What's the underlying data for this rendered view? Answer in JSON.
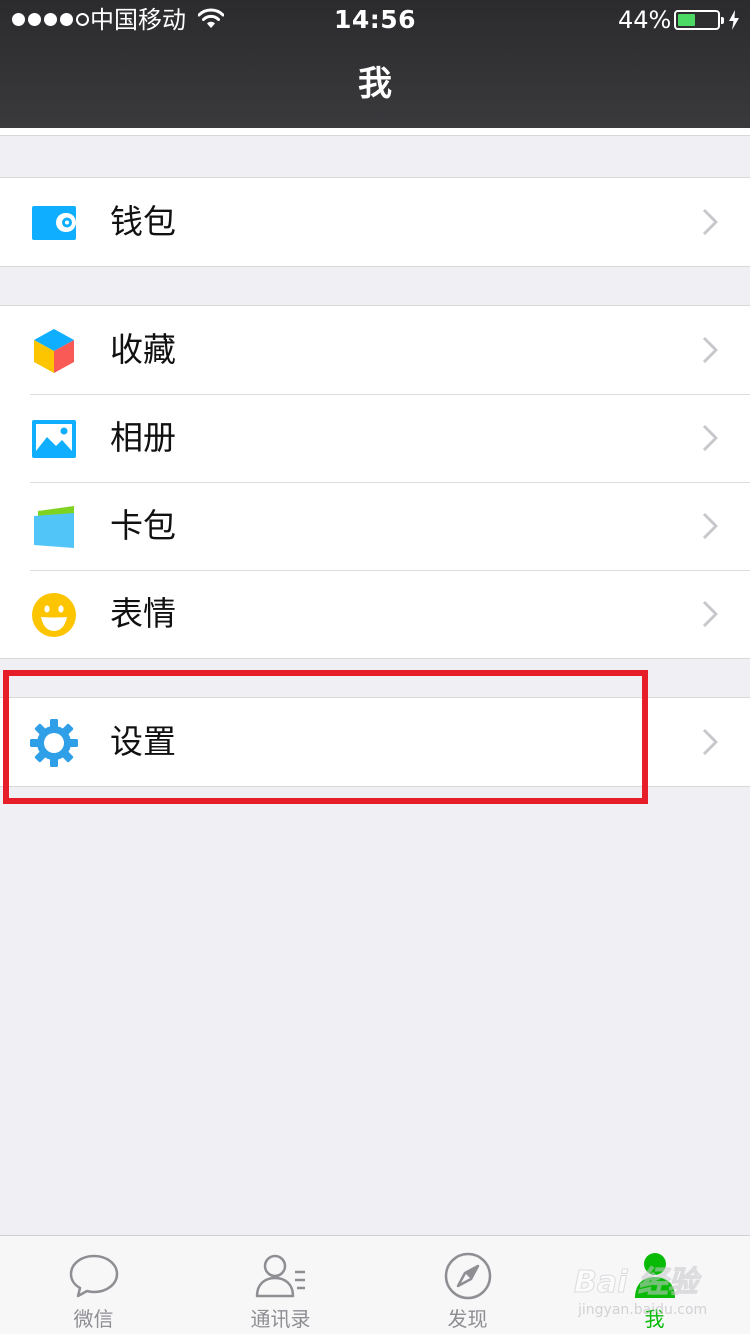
{
  "status_bar": {
    "carrier": "中国移动",
    "time": "14:56",
    "battery_percent": "44%",
    "battery_level": 0.44,
    "signal_bars_filled": 4,
    "signal_bars_total": 5
  },
  "nav": {
    "title": "我"
  },
  "groups": [
    {
      "items": [
        {
          "label": "钱包",
          "icon": "wallet-icon",
          "color": "#10aeff"
        }
      ]
    },
    {
      "items": [
        {
          "label": "收藏",
          "icon": "favorites-cube-icon",
          "color": "#fa5a55"
        },
        {
          "label": "相册",
          "icon": "album-icon",
          "color": "#10aeff"
        },
        {
          "label": "卡包",
          "icon": "card-wallet-icon",
          "color": "#52c5f8"
        },
        {
          "label": "表情",
          "icon": "smiley-icon",
          "color": "#fcc500"
        }
      ]
    },
    {
      "items": [
        {
          "label": "设置",
          "icon": "settings-gear-icon",
          "color": "#2f9fe8"
        }
      ]
    }
  ],
  "highlight": {
    "target": "设置",
    "color": "#e61e2a"
  },
  "tabbar": {
    "tabs": [
      {
        "label": "微信",
        "icon": "chat-bubble-icon",
        "active": false
      },
      {
        "label": "通讯录",
        "icon": "contacts-icon",
        "active": false
      },
      {
        "label": "发现",
        "icon": "compass-icon",
        "active": false
      },
      {
        "label": "我",
        "icon": "me-person-icon",
        "active": true
      }
    ],
    "active_color": "#09bb07",
    "inactive_color": "#8e8e93"
  },
  "watermark": {
    "main": "Bai 经验",
    "sub": "jingyan.baidu.com"
  }
}
